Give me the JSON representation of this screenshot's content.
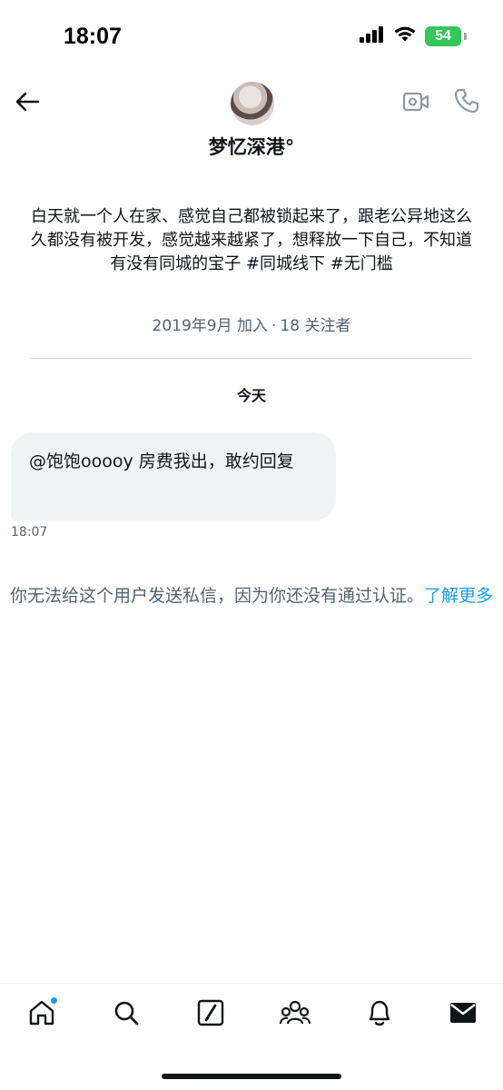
{
  "status_bar": {
    "time": "18:07",
    "battery_level": "54",
    "battery_color": "#34c759"
  },
  "header": {
    "back_icon": "arrow-left-icon",
    "name": "梦忆深港°",
    "video_icon": "video-camera-icon",
    "call_icon": "phone-icon"
  },
  "profile": {
    "bio": "白天就一个人在家、感觉自己都被锁起来了，跟老公异地这么久都没有被开发，感觉越来越紧了，想释放一下自己，不知道有没有同城的宝子 #同城线下 #无门槛",
    "joined": "2019年9月 加入",
    "separator": "·",
    "followers": "18 关注者"
  },
  "conversation": {
    "date_label": "今天",
    "messages": [
      {
        "text": "@饱饱ooooy 房费我出，敢约回复",
        "time": "18:07"
      }
    ],
    "notice_text": "你无法给这个用户发送私信，因为你还没有通过认证。",
    "notice_link": "了解更多"
  },
  "tab_bar": {
    "items": [
      {
        "icon": "home-icon",
        "unread": true
      },
      {
        "icon": "search-icon"
      },
      {
        "icon": "grok-icon"
      },
      {
        "icon": "communities-icon"
      },
      {
        "icon": "bell-icon"
      },
      {
        "icon": "envelope-icon",
        "active": true
      }
    ]
  },
  "colors": {
    "accent": "#1d9bf0",
    "secondary_text": "#536471",
    "bubble_bg": "#eff3f4"
  }
}
